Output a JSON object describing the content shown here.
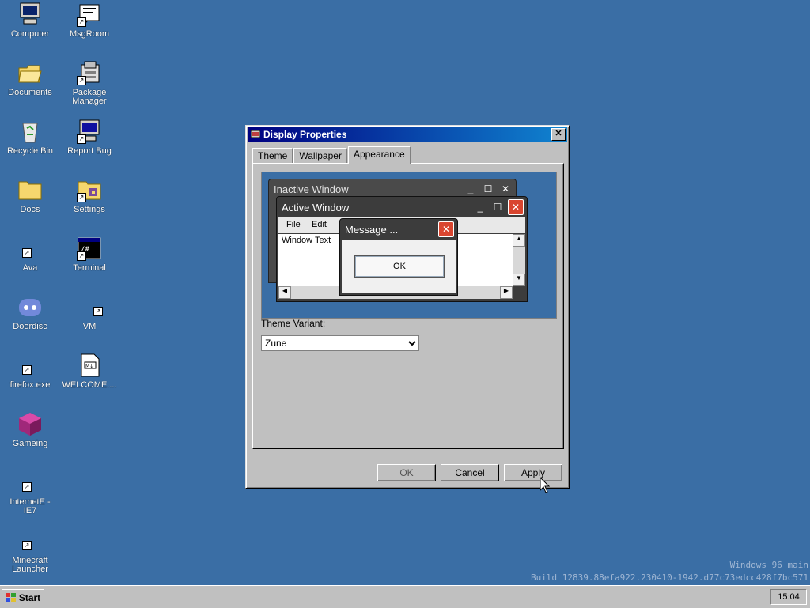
{
  "desktop": {
    "icons_col1": [
      {
        "label": "Computer",
        "icon": "computer-icon"
      },
      {
        "label": "Documents",
        "icon": "folder-open-icon"
      },
      {
        "label": "Recycle Bin",
        "icon": "recycle-bin-icon"
      },
      {
        "label": "Docs",
        "icon": "folder-icon"
      },
      {
        "label": "Ava",
        "icon": "shortcut-icon"
      },
      {
        "label": "Doordisc",
        "icon": "discord-icon"
      },
      {
        "label": "firefox.exe",
        "icon": "shortcut-icon"
      },
      {
        "label": "Gameing",
        "icon": "game-cube-icon"
      },
      {
        "label": "InternetE - IE7",
        "icon": "shortcut-icon"
      },
      {
        "label": "Minecraft Launcher",
        "icon": "shortcut-icon"
      }
    ],
    "icons_col2": [
      {
        "label": "MsgRoom",
        "icon": "msgroom-icon"
      },
      {
        "label": "Package Manager",
        "icon": "package-manager-icon"
      },
      {
        "label": "Report Bug",
        "icon": "report-bug-icon"
      },
      {
        "label": "Settings",
        "icon": "settings-icon"
      },
      {
        "label": "Terminal",
        "icon": "terminal-icon"
      },
      {
        "label": "VM",
        "icon": "shortcut-icon"
      },
      {
        "label": "WELCOME....",
        "icon": "markdown-file-icon"
      }
    ],
    "watermark_line1": "Windows 96 main",
    "watermark_line2": "Build 12839.88efa922.230410-1942.d77c73edcc428f7bc571"
  },
  "dialog": {
    "title": "Display Properties",
    "close_glyph": "✕",
    "tabs": [
      {
        "label": "Theme",
        "active": false
      },
      {
        "label": "Wallpaper",
        "active": false
      },
      {
        "label": "Appearance",
        "active": true
      }
    ],
    "preview": {
      "inactive_title": "Inactive Window",
      "active_title": "Active Window",
      "menu": [
        "File",
        "Edit"
      ],
      "window_text": "Window Text",
      "message_title": "Message ...",
      "message_ok": "OK"
    },
    "theme_variant_label": "Theme Variant:",
    "theme_variant_value": "Zune",
    "buttons": {
      "ok": "OK",
      "cancel": "Cancel",
      "apply": "Apply"
    }
  },
  "taskbar": {
    "start_label": "Start",
    "clock": "15:04"
  },
  "colors": {
    "desktop": "#3a6ea5",
    "titlebar_start": "#000080",
    "titlebar_end": "#1084d0",
    "zune_close": "#d9452f"
  }
}
